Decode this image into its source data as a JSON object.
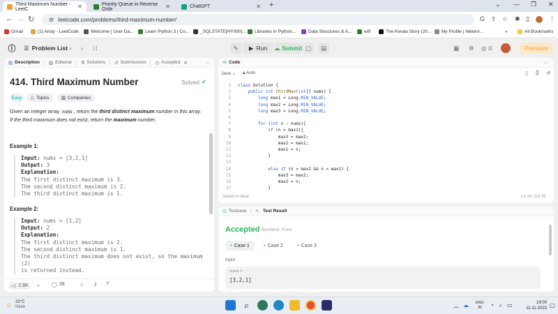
{
  "browser": {
    "tabs": [
      {
        "title": "Third Maximum Number - LeetC",
        "active": true,
        "color": "#f0a030"
      },
      {
        "title": "Priority Queue in Reverse Orde",
        "active": false,
        "color": "#2e7d32"
      },
      {
        "title": "ChatGPT",
        "active": false,
        "color": "#10a37f"
      }
    ],
    "url": "leetcode.com/problems/third-maximum-number/",
    "bookmarks": [
      "Gmail",
      "(1) Array - LeetCode",
      "Welcome | User Da...",
      "Learn Python 3 | Co...",
      "_SQLSTATE[HY000]:...",
      "Libraries in Python...",
      "Data Structures & A...",
      "wifi",
      "The Kerala Story (20...",
      "My Profile | Networ..."
    ],
    "all_bookmarks": "All Bookmarks"
  },
  "lcnav": {
    "problem_list": "Problem List",
    "run": "Run",
    "submit": "Submit",
    "streak": "0",
    "premium": "Premium"
  },
  "desc_tabs": [
    "Description",
    "Editorial",
    "Solutions",
    "Submissions",
    "Accepted"
  ],
  "problem": {
    "title": "414. Third Maximum Number",
    "status": "Solved",
    "difficulty": "Easy",
    "tag_topics": "Topics",
    "tag_companies": "Companies",
    "desc_pre": "Given an integer array ",
    "desc_code": "nums",
    "desc_mid": ", return the ",
    "desc_bold": "third distinct maximum",
    "desc_post": " number in this array.",
    "desc2_pre": "If the third maximum does not exist, return the ",
    "desc2_bold": "maximum",
    "desc2_post": " number.",
    "examples": [
      {
        "heading": "Example 1:",
        "input": "nums = [3,2,1]",
        "output": "3",
        "explanation": [
          "The first distinct maximum is 3.",
          "The second distinct maximum is 2.",
          "The third distinct maximum is 1."
        ]
      },
      {
        "heading": "Example 2:",
        "input": "nums = [1,2]",
        "output": "2",
        "explanation": [
          "The first distinct maximum is 2.",
          "The second distinct maximum is 1.",
          "The third distinct maximum does not exist, so the maximum (2)",
          "is returned instead."
        ]
      }
    ],
    "labels": {
      "input": "Input:",
      "output": "Output:",
      "explanation": "Explanation:"
    },
    "likes": "2.8K",
    "comments": "38"
  },
  "code_panel": {
    "title": "Code",
    "language": "Java",
    "auto": "Auto",
    "saved": "Saved to local",
    "cursor": "Ln 18, Col 35",
    "lines": [
      "class Solution {",
      "    public int thirdMax(int[] nums) {",
      "        long max1 = Long.MIN_VALUE;",
      "        long max2 = Long.MIN_VALUE;",
      "        long max3 = Long.MIN_VALUE;",
      "",
      "        for (int n : nums){",
      "            if (n > max1){",
      "                max3 = max2;",
      "                max2 = max1;",
      "                max1 = n;",
      "            }",
      "",
      "            else if (n > max2 && n < max1) {",
      "                max3 = max2;",
      "                max2 = n;",
      "            }"
    ]
  },
  "result_panel": {
    "tab_testcase": "Testcase",
    "tab_result": "Test Result",
    "status": "Accepted",
    "runtime": "Runtime: 0 ms",
    "cases": [
      "Case 1",
      "Case 2",
      "Case 3"
    ],
    "input_label": "Input",
    "var_label": "nums =",
    "var_value": "[3,2,1]"
  },
  "taskbar": {
    "temp": "22°C",
    "weather": "Haze",
    "lang1": "ENG",
    "lang2": "IN",
    "time": "19:00",
    "date": "11-11-2023"
  },
  "colors": {
    "accent_green": "#2db55d",
    "premium": "#ffa116",
    "easy": "#00af9b"
  }
}
